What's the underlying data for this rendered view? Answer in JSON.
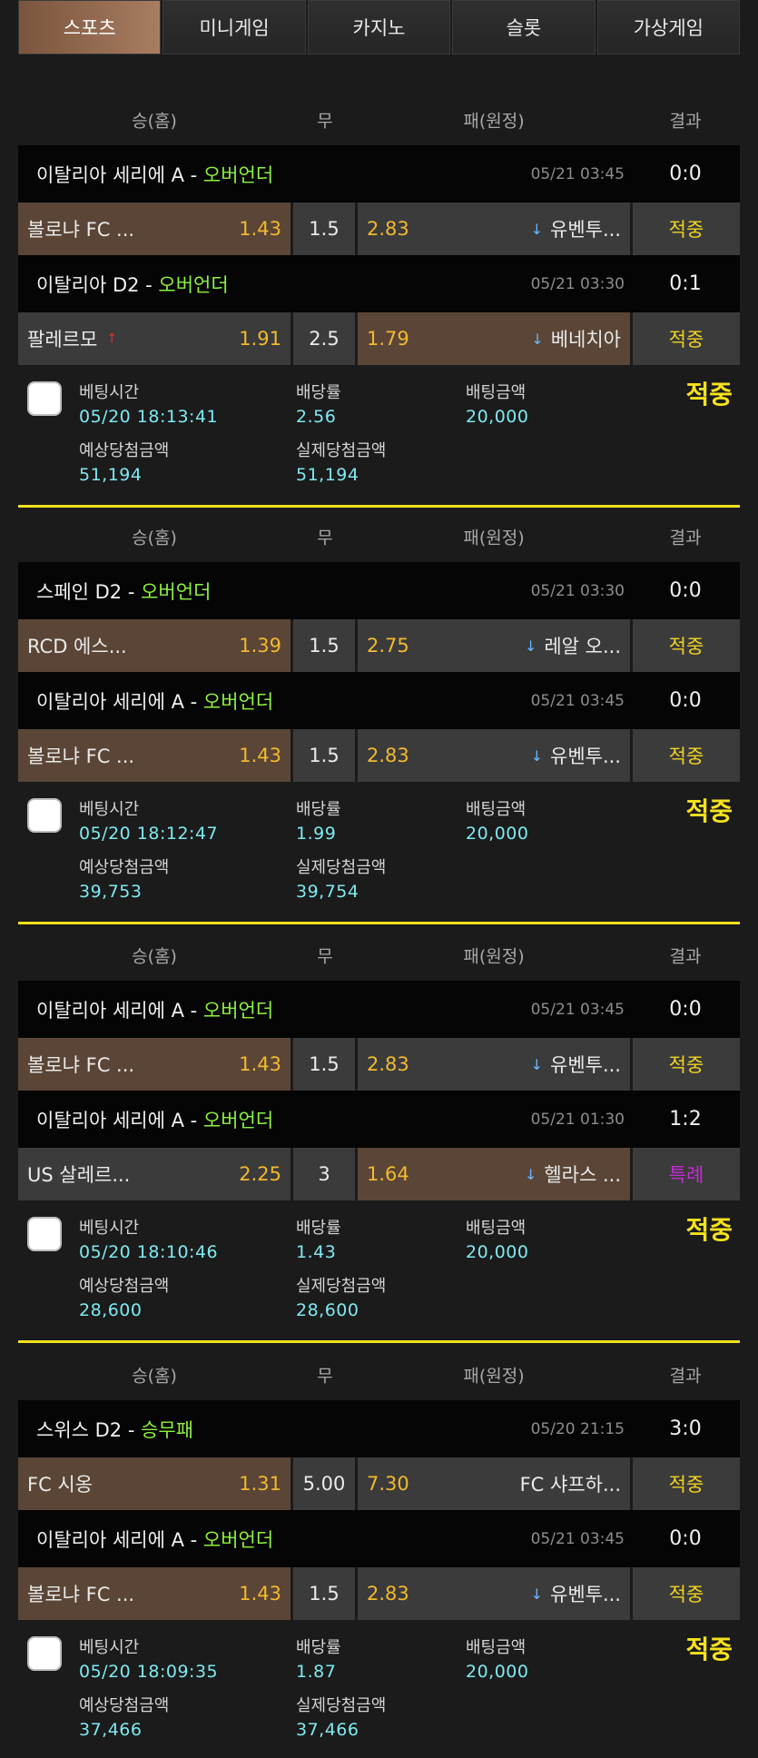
{
  "tabs": [
    {
      "label": "스포츠",
      "active": true
    },
    {
      "label": "미니게임"
    },
    {
      "label": "카지노"
    },
    {
      "label": "슬롯"
    },
    {
      "label": "가상게임"
    }
  ],
  "header": {
    "home": "승(홈)",
    "draw": "무",
    "away": "패(원정)",
    "result": "결과"
  },
  "bet_labels": {
    "bet_time": "베팅시간",
    "odds": "배당률",
    "bet_amount": "배팅금액",
    "expected": "예상당첨금액",
    "actual": "실제당첨금액"
  },
  "slips": [
    {
      "games": [
        {
          "league": "이탈리아 세리에 A - ",
          "market": "오버언더",
          "time": "05/21 03:45",
          "score": "0:0",
          "home": "볼로냐 FC ...",
          "home_odd": "1.43",
          "draw": "1.5",
          "away_odd": "2.83",
          "away": "유벤투...",
          "result": "적중"
        },
        {
          "league": "이탈리아 D2 - ",
          "market": "오버언더",
          "time": "05/21 03:30",
          "score": "0:1",
          "home": "팔레르모",
          "home_odd": "1.91",
          "draw": "2.5",
          "away_odd": "1.79",
          "away": "베네치아",
          "result": "적중"
        }
      ],
      "bet_time": "05/20 18:13:41",
      "odds": "2.56",
      "amount": "20,000",
      "expected": "51,194",
      "actual": "51,194",
      "status": "적중"
    },
    {
      "games": [
        {
          "league": "스페인 D2 - ",
          "market": "오버언더",
          "time": "05/21 03:30",
          "score": "0:0",
          "home": "RCD 에스...",
          "home_odd": "1.39",
          "draw": "1.5",
          "away_odd": "2.75",
          "away": "레알 오...",
          "result": "적중"
        },
        {
          "league": "이탈리아 세리에 A - ",
          "market": "오버언더",
          "time": "05/21 03:45",
          "score": "0:0",
          "home": "볼로냐 FC ...",
          "home_odd": "1.43",
          "draw": "1.5",
          "away_odd": "2.83",
          "away": "유벤투...",
          "result": "적중"
        }
      ],
      "bet_time": "05/20 18:12:47",
      "odds": "1.99",
      "amount": "20,000",
      "expected": "39,753",
      "actual": "39,754",
      "status": "적중"
    },
    {
      "games": [
        {
          "league": "이탈리아 세리에 A - ",
          "market": "오버언더",
          "time": "05/21 03:45",
          "score": "0:0",
          "home": "볼로냐 FC ...",
          "home_odd": "1.43",
          "draw": "1.5",
          "away_odd": "2.83",
          "away": "유벤투...",
          "result": "적중"
        },
        {
          "league": "이탈리아 세리에 A - ",
          "market": "오버언더",
          "time": "05/21 01:30",
          "score": "1:2",
          "home": "US 살레르...",
          "home_odd": "2.25",
          "draw": "3",
          "away_odd": "1.64",
          "away": "헬라스 ...",
          "result": "특례"
        }
      ],
      "bet_time": "05/20 18:10:46",
      "odds": "1.43",
      "amount": "20,000",
      "expected": "28,600",
      "actual": "28,600",
      "status": "적중"
    },
    {
      "games": [
        {
          "league": "스위스 D2 - ",
          "market": "승무패",
          "time": "05/20 21:15",
          "score": "3:0",
          "home": "FC 시옹",
          "home_odd": "1.31",
          "draw": "5.00",
          "away_odd": "7.30",
          "away": "FC 샤프하...",
          "result": "적중"
        },
        {
          "league": "이탈리아 세리에 A - ",
          "market": "오버언더",
          "time": "05/21 03:45",
          "score": "0:0",
          "home": "볼로냐 FC ...",
          "home_odd": "1.43",
          "draw": "1.5",
          "away_odd": "2.83",
          "away": "유벤투...",
          "result": "적중"
        }
      ],
      "bet_time": "05/20 18:09:35",
      "odds": "1.87",
      "amount": "20,000",
      "expected": "37,466",
      "actual": "37,466",
      "status": "적중"
    }
  ]
}
